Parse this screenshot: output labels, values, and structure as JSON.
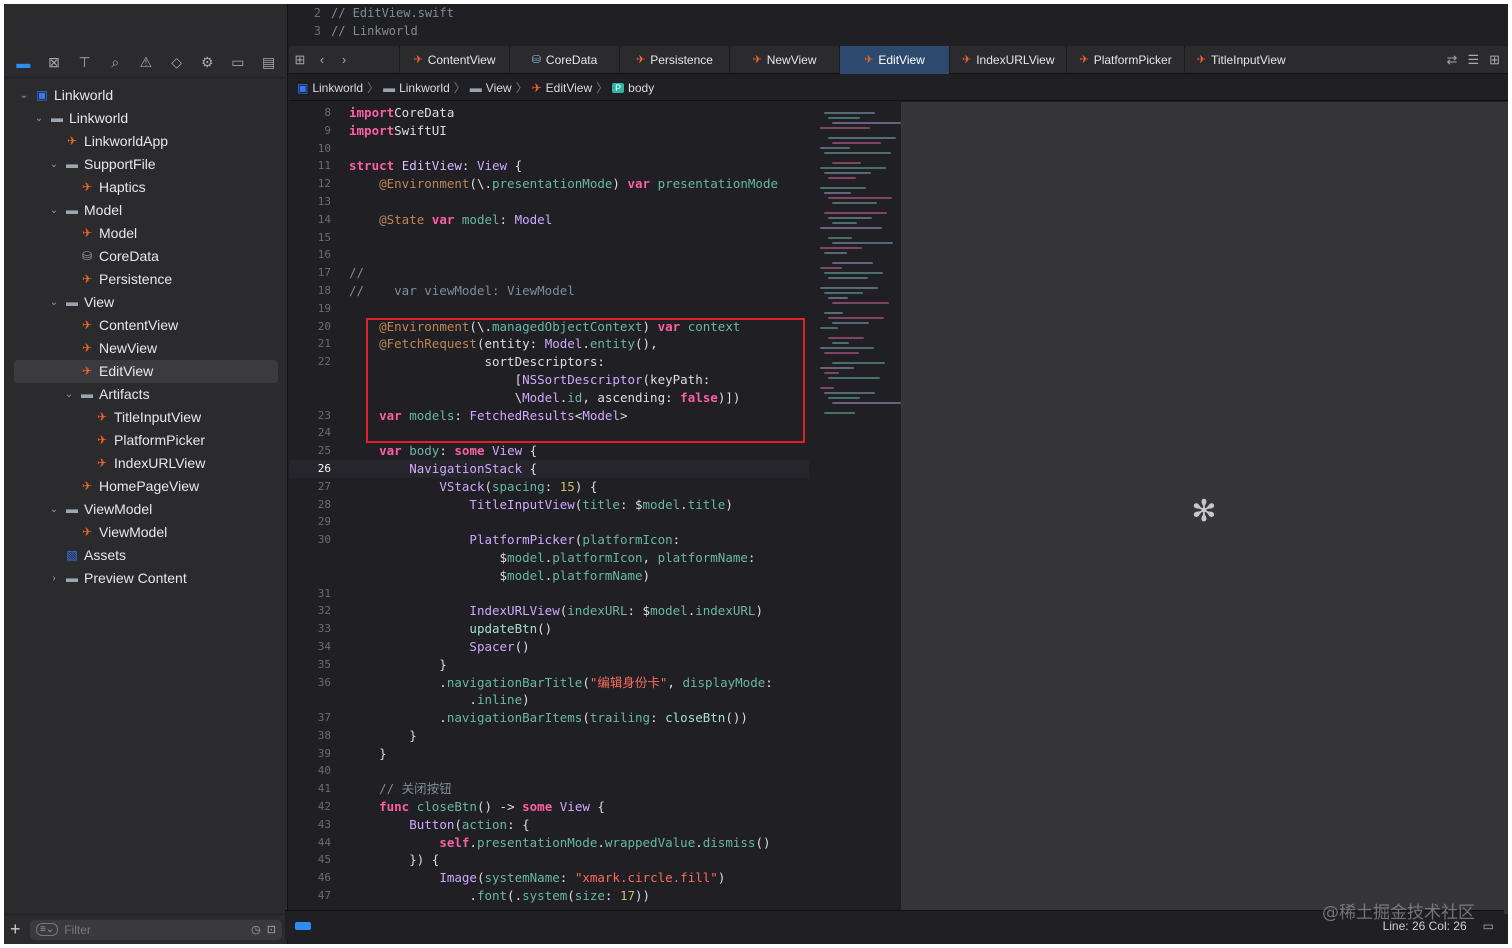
{
  "sidebar": {
    "nav_icons": [
      "folder-icon",
      "source-control-icon",
      "symbols-icon",
      "find-icon",
      "issues-icon",
      "tests-icon",
      "debug-icon",
      "breakpoints-icon",
      "reports-icon"
    ],
    "tree": [
      {
        "label": "Linkworld",
        "depth": 0,
        "icon": "app",
        "chev": "v"
      },
      {
        "label": "Linkworld",
        "depth": 1,
        "icon": "folder",
        "chev": "v"
      },
      {
        "label": "LinkworldApp",
        "depth": 2,
        "icon": "swift",
        "chev": ""
      },
      {
        "label": "SupportFile",
        "depth": 2,
        "icon": "folder",
        "chev": "v"
      },
      {
        "label": "Haptics",
        "depth": 3,
        "icon": "swift",
        "chev": ""
      },
      {
        "label": "Model",
        "depth": 2,
        "icon": "folder",
        "chev": "v"
      },
      {
        "label": "Model",
        "depth": 3,
        "icon": "swift",
        "chev": ""
      },
      {
        "label": "CoreData",
        "depth": 3,
        "icon": "data",
        "chev": ""
      },
      {
        "label": "Persistence",
        "depth": 3,
        "icon": "swift",
        "chev": ""
      },
      {
        "label": "View",
        "depth": 2,
        "icon": "folder",
        "chev": "v"
      },
      {
        "label": "ContentView",
        "depth": 3,
        "icon": "swift",
        "chev": ""
      },
      {
        "label": "NewView",
        "depth": 3,
        "icon": "swift",
        "chev": ""
      },
      {
        "label": "EditView",
        "depth": 3,
        "icon": "swift",
        "chev": "",
        "selected": true
      },
      {
        "label": "Artifacts",
        "depth": 3,
        "icon": "folder",
        "chev": "v"
      },
      {
        "label": "TitleInputView",
        "depth": 4,
        "icon": "swift",
        "chev": ""
      },
      {
        "label": "PlatformPicker",
        "depth": 4,
        "icon": "swift",
        "chev": ""
      },
      {
        "label": "IndexURLView",
        "depth": 4,
        "icon": "swift",
        "chev": ""
      },
      {
        "label": "HomePageView",
        "depth": 3,
        "icon": "swift",
        "chev": ""
      },
      {
        "label": "ViewModel",
        "depth": 2,
        "icon": "folder",
        "chev": "v"
      },
      {
        "label": "ViewModel",
        "depth": 3,
        "icon": "swift",
        "chev": ""
      },
      {
        "label": "Assets",
        "depth": 2,
        "icon": "assets",
        "chev": ""
      },
      {
        "label": "Preview Content",
        "depth": 2,
        "icon": "folder",
        "chev": ">"
      }
    ],
    "filter_placeholder": "Filter"
  },
  "prev_file": [
    {
      "n": "2",
      "text": "//  EditView.swift"
    },
    {
      "n": "3",
      "text": "//  Linkworld"
    }
  ],
  "tabs": [
    {
      "label": "ContentView",
      "icon": "swift"
    },
    {
      "label": "CoreData",
      "icon": "data"
    },
    {
      "label": "Persistence",
      "icon": "swift"
    },
    {
      "label": "NewView",
      "icon": "swift"
    },
    {
      "label": "EditView",
      "icon": "swift",
      "active": true
    },
    {
      "label": "IndexURLView",
      "icon": "swift"
    },
    {
      "label": "PlatformPicker",
      "icon": "swift"
    },
    {
      "label": "TitleInputView",
      "icon": "swift"
    }
  ],
  "breadcrumb": [
    "Linkworld",
    "Linkworld",
    "View",
    "EditView",
    "body"
  ],
  "code": [
    {
      "n": "8",
      "t": [
        [
          "kw",
          "import"
        ],
        [
          "",
          "CoreData"
        ]
      ]
    },
    {
      "n": "9",
      "t": [
        [
          "kw",
          "import"
        ],
        [
          "",
          "SwiftUI"
        ]
      ]
    },
    {
      "n": "10",
      "t": []
    },
    {
      "n": "11",
      "t": [
        [
          "kw",
          "struct"
        ],
        [
          "",
          "",
          1
        ],
        [
          "tyn",
          "EditView"
        ],
        [
          "",
          ": "
        ],
        [
          "ty",
          "View"
        ],
        [
          "",
          " {"
        ]
      ]
    },
    {
      "n": "12",
      "t": [
        [
          "",
          "    "
        ],
        [
          "at",
          "@Environment"
        ],
        [
          "",
          "(\\."
        ],
        [
          "mt",
          "presentationMode"
        ],
        [
          "",
          ") "
        ],
        [
          "kw",
          "var"
        ],
        [
          "",
          " "
        ],
        [
          "pr",
          "presentationMode"
        ]
      ]
    },
    {
      "n": "13",
      "t": []
    },
    {
      "n": "14",
      "t": [
        [
          "",
          "    "
        ],
        [
          "at",
          "@State"
        ],
        [
          "",
          " "
        ],
        [
          "kw",
          "var"
        ],
        [
          "",
          " "
        ],
        [
          "pr",
          "model"
        ],
        [
          "",
          ": "
        ],
        [
          "ty",
          "Model"
        ]
      ]
    },
    {
      "n": "15",
      "t": []
    },
    {
      "n": "16",
      "t": []
    },
    {
      "n": "17",
      "t": [
        [
          "cm",
          "//"
        ]
      ]
    },
    {
      "n": "18",
      "t": [
        [
          "cm",
          "//    var viewModel: ViewModel"
        ]
      ]
    },
    {
      "n": "19",
      "t": []
    },
    {
      "n": "20",
      "t": [
        [
          "",
          "    "
        ],
        [
          "at",
          "@Environment"
        ],
        [
          "",
          "(\\."
        ],
        [
          "mt",
          "managedObjectContext"
        ],
        [
          "",
          ") "
        ],
        [
          "kw",
          "var"
        ],
        [
          "",
          " "
        ],
        [
          "pr",
          "context"
        ]
      ]
    },
    {
      "n": "21",
      "t": [
        [
          "",
          "    "
        ],
        [
          "at",
          "@FetchRequest"
        ],
        [
          "",
          "(entity: "
        ],
        [
          "ty",
          "Model"
        ],
        [
          "",
          "."
        ],
        [
          "mt",
          "entity"
        ],
        [
          "",
          "(),"
        ]
      ]
    },
    {
      "n": "22",
      "t": [
        [
          "",
          "                  sortDescriptors:"
        ]
      ]
    },
    {
      "n": "",
      "t": [
        [
          "",
          "                      ["
        ],
        [
          "ty",
          "NSSortDescriptor"
        ],
        [
          "",
          "(keyPath:"
        ]
      ]
    },
    {
      "n": "",
      "t": [
        [
          "",
          "                      \\"
        ],
        [
          "ty",
          "Model"
        ],
        [
          "",
          "."
        ],
        [
          "mt",
          "id"
        ],
        [
          "",
          ", ascending: "
        ],
        [
          "kw",
          "false"
        ],
        [
          "",
          ")])"
        ]
      ]
    },
    {
      "n": "23",
      "t": [
        [
          "",
          "    "
        ],
        [
          "kw",
          "var"
        ],
        [
          "",
          " "
        ],
        [
          "pr",
          "models"
        ],
        [
          "",
          ": "
        ],
        [
          "ty",
          "FetchedResults"
        ],
        [
          "",
          "<"
        ],
        [
          "ty",
          "Model"
        ],
        [
          "",
          ">"
        ]
      ]
    },
    {
      "n": "24",
      "t": []
    },
    {
      "n": "25",
      "t": [
        [
          "",
          "    "
        ],
        [
          "kw",
          "var"
        ],
        [
          "",
          " "
        ],
        [
          "pr",
          "body"
        ],
        [
          "",
          ": "
        ],
        [
          "kw",
          "some"
        ],
        [
          "",
          " "
        ],
        [
          "ty",
          "View"
        ],
        [
          "",
          " {"
        ]
      ]
    },
    {
      "n": "26",
      "t": [
        [
          "",
          "        "
        ],
        [
          "ty",
          "NavigationStack"
        ],
        [
          "",
          " {"
        ]
      ],
      "cur": true
    },
    {
      "n": "27",
      "t": [
        [
          "",
          "            "
        ],
        [
          "ty",
          "VStack"
        ],
        [
          "",
          "("
        ],
        [
          "mt",
          "spacing"
        ],
        [
          "",
          ": "
        ],
        [
          "nm",
          "15"
        ],
        [
          "",
          ") {"
        ]
      ]
    },
    {
      "n": "28",
      "t": [
        [
          "",
          "                "
        ],
        [
          "ty",
          "TitleInputView"
        ],
        [
          "",
          "("
        ],
        [
          "mt",
          "title"
        ],
        [
          "",
          ": $"
        ],
        [
          "mt",
          "model"
        ],
        [
          "",
          "."
        ],
        [
          "mt",
          "title"
        ],
        [
          "",
          ")"
        ]
      ]
    },
    {
      "n": "29",
      "t": []
    },
    {
      "n": "30",
      "t": [
        [
          "",
          "                "
        ],
        [
          "ty",
          "PlatformPicker"
        ],
        [
          "",
          "("
        ],
        [
          "mt",
          "platformIcon"
        ],
        [
          "",
          ":"
        ]
      ]
    },
    {
      "n": "",
      "t": [
        [
          "",
          "                    $"
        ],
        [
          "mt",
          "model"
        ],
        [
          "",
          "."
        ],
        [
          "mt",
          "platformIcon"
        ],
        [
          "",
          ", "
        ],
        [
          "mt",
          "platformName"
        ],
        [
          "",
          ":"
        ]
      ]
    },
    {
      "n": "",
      "t": [
        [
          "",
          "                    $"
        ],
        [
          "mt",
          "model"
        ],
        [
          "",
          "."
        ],
        [
          "mt",
          "platformName"
        ],
        [
          "",
          ")"
        ]
      ]
    },
    {
      "n": "31",
      "t": []
    },
    {
      "n": "32",
      "t": [
        [
          "",
          "                "
        ],
        [
          "ty",
          "IndexURLView"
        ],
        [
          "",
          "("
        ],
        [
          "mt",
          "indexURL"
        ],
        [
          "",
          ": $"
        ],
        [
          "mt",
          "model"
        ],
        [
          "",
          "."
        ],
        [
          "mt",
          "indexURL"
        ],
        [
          "",
          ")"
        ]
      ]
    },
    {
      "n": "33",
      "t": [
        [
          "",
          "                "
        ],
        [
          "fn",
          "updateBtn"
        ],
        [
          "",
          "()"
        ]
      ]
    },
    {
      "n": "34",
      "t": [
        [
          "",
          "                "
        ],
        [
          "ty",
          "Spacer"
        ],
        [
          "",
          "()"
        ]
      ]
    },
    {
      "n": "35",
      "t": [
        [
          "",
          "            }"
        ]
      ]
    },
    {
      "n": "36",
      "t": [
        [
          "",
          "            ."
        ],
        [
          "mt",
          "navigationBarTitle"
        ],
        [
          "",
          "("
        ],
        [
          "st",
          "\"编辑身份卡\""
        ],
        [
          "",
          ", "
        ],
        [
          "mt",
          "displayMode"
        ],
        [
          "",
          ":"
        ]
      ]
    },
    {
      "n": "",
      "t": [
        [
          "",
          "                ."
        ],
        [
          "mt",
          "inline"
        ],
        [
          "",
          ")"
        ]
      ]
    },
    {
      "n": "37",
      "t": [
        [
          "",
          "            ."
        ],
        [
          "mt",
          "navigationBarItems"
        ],
        [
          "",
          "("
        ],
        [
          "mt",
          "trailing"
        ],
        [
          "",
          ": "
        ],
        [
          "fn",
          "closeBtn"
        ],
        [
          "",
          "())"
        ]
      ]
    },
    {
      "n": "38",
      "t": [
        [
          "",
          "        }"
        ]
      ]
    },
    {
      "n": "39",
      "t": [
        [
          "",
          "    }"
        ]
      ]
    },
    {
      "n": "40",
      "t": []
    },
    {
      "n": "41",
      "t": [
        [
          "",
          "    "
        ],
        [
          "cm",
          "// 关闭按钮"
        ]
      ]
    },
    {
      "n": "42",
      "t": [
        [
          "",
          "    "
        ],
        [
          "kw",
          "func"
        ],
        [
          "",
          " "
        ],
        [
          "pr",
          "closeBtn"
        ],
        [
          "",
          "() -> "
        ],
        [
          "kw",
          "some"
        ],
        [
          "",
          " "
        ],
        [
          "ty",
          "View"
        ],
        [
          "",
          " {"
        ]
      ]
    },
    {
      "n": "43",
      "t": [
        [
          "",
          "        "
        ],
        [
          "ty",
          "Button"
        ],
        [
          "",
          "("
        ],
        [
          "mt",
          "action"
        ],
        [
          "",
          ": {"
        ]
      ]
    },
    {
      "n": "44",
      "t": [
        [
          "",
          "            "
        ],
        [
          "kw",
          "self"
        ],
        [
          "",
          "."
        ],
        [
          "mt",
          "presentationMode"
        ],
        [
          "",
          "."
        ],
        [
          "mt",
          "wrappedValue"
        ],
        [
          "",
          "."
        ],
        [
          "mt",
          "dismiss"
        ],
        [
          "",
          "()"
        ]
      ]
    },
    {
      "n": "45",
      "t": [
        [
          "",
          "        }) {"
        ]
      ]
    },
    {
      "n": "46",
      "t": [
        [
          "",
          "            "
        ],
        [
          "ty",
          "Image"
        ],
        [
          "",
          "("
        ],
        [
          "mt",
          "systemName"
        ],
        [
          "",
          ": "
        ],
        [
          "st",
          "\"xmark.circle.fill\""
        ],
        [
          "",
          ")"
        ]
      ]
    },
    {
      "n": "47",
      "t": [
        [
          "",
          "                ."
        ],
        [
          "mt",
          "font"
        ],
        [
          "",
          "(."
        ],
        [
          "mt",
          "system"
        ],
        [
          "",
          "("
        ],
        [
          "mt",
          "size"
        ],
        [
          "",
          ": "
        ],
        [
          "nm",
          "17"
        ],
        [
          "",
          "))"
        ]
      ]
    }
  ],
  "status": {
    "position": "Line: 26  Col: 26"
  },
  "watermark": "@稀土掘金技术社区",
  "colors": {
    "accent": "#2f8cf0",
    "swift": "#f0642c",
    "highlight_box": "#e0202a",
    "active_tab": "#2d4a6e"
  }
}
